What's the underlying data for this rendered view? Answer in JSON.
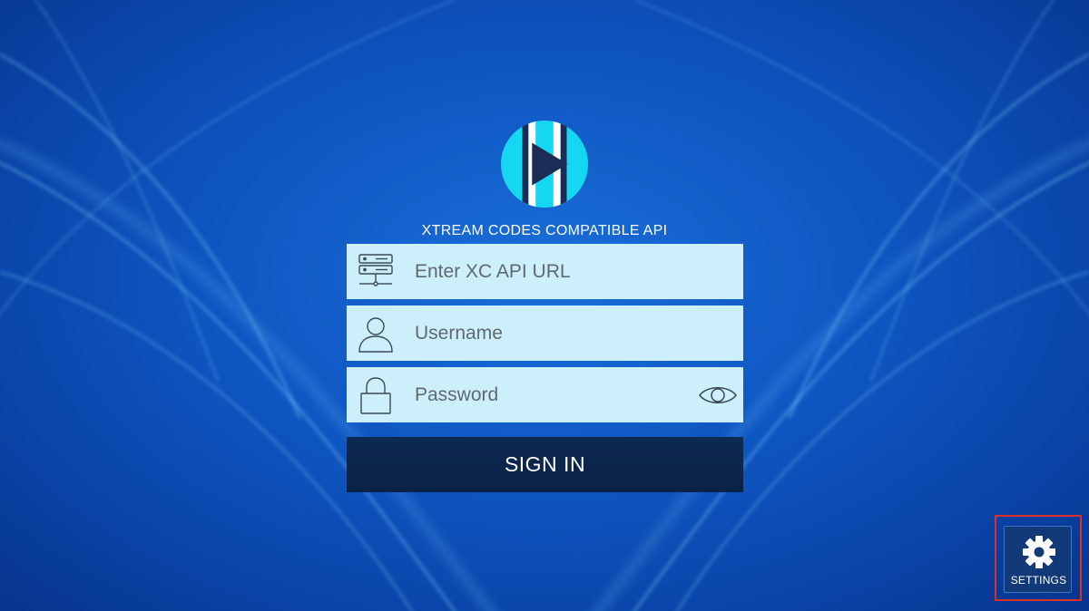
{
  "login": {
    "heading": "XTREAM CODES COMPATIBLE API",
    "url_placeholder": "Enter XC API URL",
    "username_placeholder": "Username",
    "password_placeholder": "Password",
    "sign_in_label": "SIGN IN"
  },
  "settings": {
    "label": "SETTINGS"
  },
  "icons": {
    "logo": "play-logo-icon",
    "url": "server-icon",
    "username": "user-icon",
    "password": "lock-icon",
    "toggle": "eye-icon",
    "settings": "gear-icon"
  },
  "colors": {
    "background": "#0f58c4",
    "field_bg": "#cdeefb",
    "button_bg": "#0e2a52",
    "logo_cyan": "#16d7f2",
    "logo_navy": "#1a2d57",
    "highlight": "#d9302c"
  }
}
